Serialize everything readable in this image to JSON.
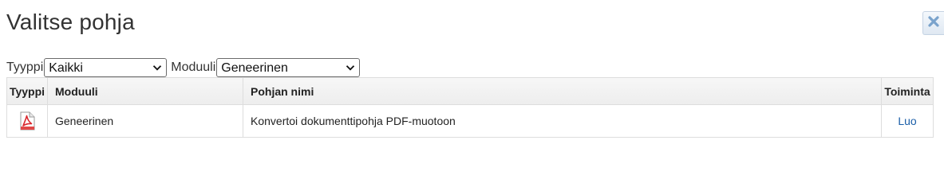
{
  "dialog": {
    "title": "Valitse pohja",
    "close_icon": "close-x-icon"
  },
  "filters": {
    "type_label": "Tyyppi",
    "type_value": "Kaikki",
    "module_label": "Moduuli",
    "module_value": "Geneerinen"
  },
  "table": {
    "columns": [
      "Tyyppi",
      "Moduuli",
      "Pohjan nimi",
      "Toiminta"
    ],
    "rows": [
      {
        "type_icon": "pdf-file-icon",
        "module": "Geneerinen",
        "name": "Konvertoi dokumenttipohja PDF-muotoon",
        "action": "Luo"
      }
    ]
  },
  "colors": {
    "link": "#1a5ea8",
    "close_icon": "#7aa3cc",
    "pdf_red": "#d9262c"
  }
}
